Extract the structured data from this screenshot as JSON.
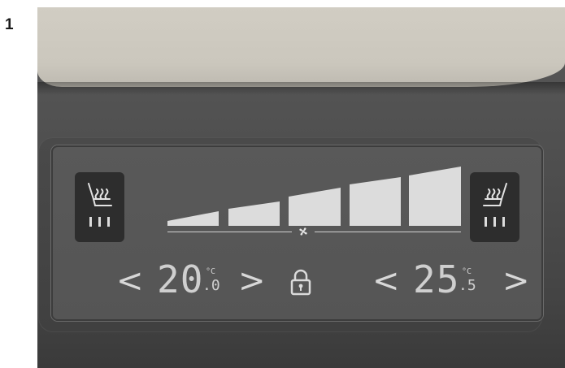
{
  "step_number": "1",
  "climate_panel": {
    "left_seat_heat": {
      "icon": "seat-heater-icon",
      "level_bars": 3
    },
    "right_seat_heat": {
      "icon": "seat-heater-icon",
      "level_bars": 3
    },
    "fan": {
      "icon": "fan-icon",
      "levels": 5
    },
    "left_temp": {
      "value": "20",
      "unit": "°C",
      "decimal": ".0"
    },
    "right_temp": {
      "value": "25",
      "unit": "°C",
      "decimal": ".5"
    },
    "lock": {
      "icon": "lock-icon"
    },
    "decrease_symbol": "<",
    "increase_symbol": ">"
  },
  "colors": {
    "display_text": "#cfcfcf",
    "screen_bg": "#575757",
    "button_bg": "#2d2d2d",
    "trim": "#cbc7bd"
  }
}
